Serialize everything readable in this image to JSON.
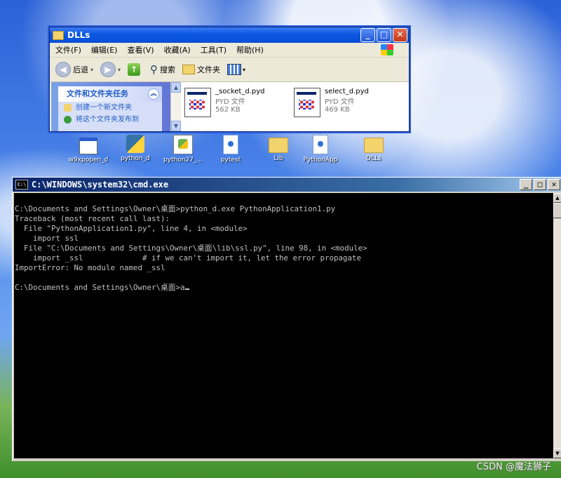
{
  "explorer": {
    "title": "DLLs",
    "menu": [
      "文件(F)",
      "编辑(E)",
      "查看(V)",
      "收藏(A)",
      "工具(T)",
      "帮助(H)"
    ],
    "toolbar": {
      "back": "后退",
      "search": "搜索",
      "folders": "文件夹"
    },
    "tasks": {
      "header": "文件和文件夹任务",
      "items": [
        "创建一个新文件夹",
        "将这个文件夹发布到"
      ]
    },
    "files": [
      {
        "name": "_socket_d.pyd",
        "type": "PYD 文件",
        "size": "562 KB"
      },
      {
        "name": "select_d.pyd",
        "type": "PYD 文件",
        "size": "469 KB"
      }
    ]
  },
  "desktop_icons": [
    {
      "label": "w9xpopen_d",
      "icon": "exe-icon"
    },
    {
      "label": "python_d",
      "icon": "python-icon"
    },
    {
      "label": "python27_...",
      "icon": "python-dll-icon"
    },
    {
      "label": "pytest",
      "icon": "document-icon"
    },
    {
      "label": "Lib",
      "icon": "folder-icon"
    },
    {
      "label": "PythonApp",
      "icon": "document-icon"
    },
    {
      "label": "DLLs",
      "icon": "folder-icon"
    }
  ],
  "cmd": {
    "title": "C:\\WINDOWS\\system32\\cmd.exe",
    "lines": [
      "C:\\Documents and Settings\\Owner\\桌面>python_d.exe PythonApplication1.py",
      "Traceback (most recent call last):",
      "  File \"PythonApplication1.py\", line 4, in <module>",
      "    import ssl",
      "  File \"C:\\Documents and Settings\\Owner\\桌面\\lib\\ssl.py\", line 98, in <module>",
      "    import _ssl             # if we can't import it, let the error propagate",
      "ImportError: No module named _ssl",
      "",
      "C:\\Documents and Settings\\Owner\\桌面>a"
    ]
  },
  "watermark": "CSDN @魔法狮子"
}
